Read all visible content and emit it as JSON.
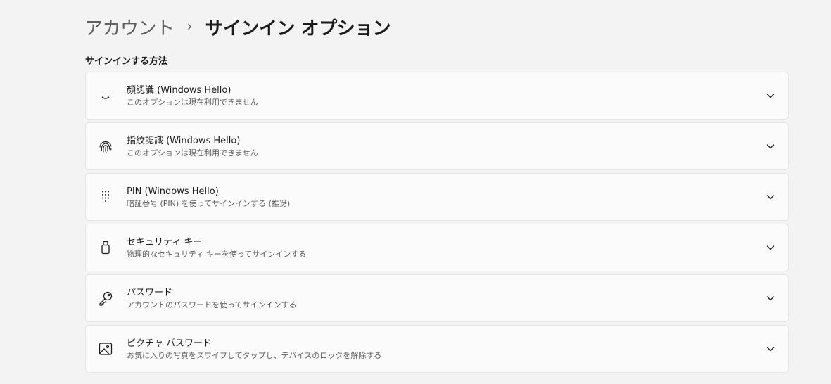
{
  "breadcrumb": {
    "parent": "アカウント",
    "separator": "›",
    "current": "サインイン オプション"
  },
  "section": {
    "title": "サインインする方法"
  },
  "options": [
    {
      "title": "顔認識 (Windows Hello)",
      "subtitle": "このオプションは現在利用できません",
      "icon": "face-icon"
    },
    {
      "title": "指紋認識 (Windows Hello)",
      "subtitle": "このオプションは現在利用できません",
      "icon": "fingerprint-icon"
    },
    {
      "title": "PIN (Windows Hello)",
      "subtitle": "暗証番号 (PIN) を使ってサインインする (推奨)",
      "icon": "pin-keypad-icon"
    },
    {
      "title": "セキュリティ キー",
      "subtitle": "物理的なセキュリティ キーを使ってサインインする",
      "icon": "usb-key-icon"
    },
    {
      "title": "パスワード",
      "subtitle": "アカウントのパスワードを使ってサインインする",
      "icon": "key-icon"
    },
    {
      "title": "ピクチャ パスワード",
      "subtitle": "お気に入りの写真をスワイプしてタップし、デバイスのロックを解除する",
      "icon": "picture-icon"
    }
  ],
  "colors": {
    "background": "#f3f3f3",
    "card": "#fbfbfb",
    "card_border": "#e5e5e5",
    "text_primary": "#1b1b1b",
    "text_secondary": "#5c5c5c"
  }
}
